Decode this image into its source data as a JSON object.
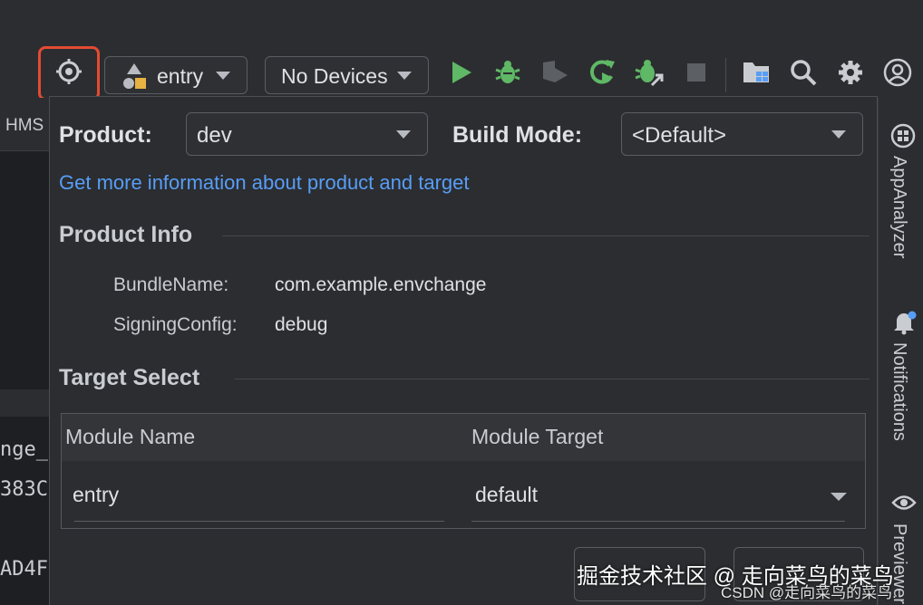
{
  "toolbar": {
    "module_select": "entry",
    "device_select": "No Devices",
    "icons": [
      "target-icon",
      "run-icon",
      "debug-icon",
      "profiler-icon",
      "apply-changes-icon",
      "attach-debugger-icon",
      "stop-icon",
      "project-structure-icon",
      "search-icon",
      "settings-icon",
      "account-icon"
    ]
  },
  "editor": {
    "tab_label": "HMS",
    "code_lines": [
      "nge_",
      "383C",
      "AD4F"
    ]
  },
  "right_strip": {
    "app_analyzer": "AppAnalyzer",
    "notifications": "Notifications",
    "previewer": "Previewer"
  },
  "panel": {
    "product_label": "Product:",
    "product_value": "dev",
    "build_mode_label": "Build Mode:",
    "build_mode_value": "<Default>",
    "info_link": "Get more information about product and target",
    "product_info_title": "Product Info",
    "bundle_name_key": "BundleName:",
    "bundle_name_value": "com.example.envchange",
    "signing_key": "SigningConfig:",
    "signing_value": "debug",
    "target_select_title": "Target Select",
    "table": {
      "col_module_name": "Module Name",
      "col_module_target": "Module Target",
      "row_module": "entry",
      "row_target": "default"
    }
  },
  "watermark": {
    "big": "掘金技术社区 @ 走向菜鸟的菜鸟",
    "small": "CSDN @走向菜鸟的菜鸟."
  },
  "colors": {
    "accent_link": "#589df6",
    "run_green": "#5fb865",
    "highlight_red": "#e34b32",
    "background": "#2b2d30"
  }
}
